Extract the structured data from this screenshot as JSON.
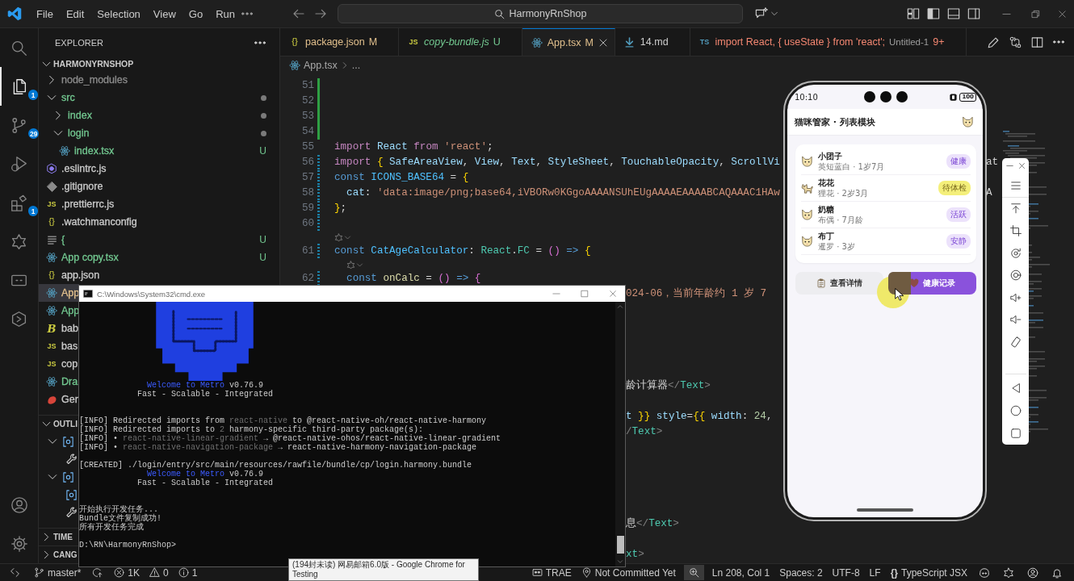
{
  "titlebar": {
    "menu": [
      {
        "label": "File"
      },
      {
        "label": "Edit"
      },
      {
        "label": "Selection"
      },
      {
        "label": "View"
      },
      {
        "label": "Go"
      },
      {
        "label": "Run"
      }
    ],
    "search": {
      "value": "HarmonyRnShop"
    }
  },
  "activity_bar": {
    "items": [
      {
        "kind": "search",
        "selected": false
      },
      {
        "kind": "explorer",
        "selected": true,
        "badge": "1"
      },
      {
        "kind": "source-control",
        "selected": false,
        "badge": "29"
      },
      {
        "kind": "run-debug",
        "selected": false
      },
      {
        "kind": "extensions",
        "selected": false,
        "badge": "1"
      },
      {
        "kind": "spark",
        "selected": false
      },
      {
        "kind": "remote",
        "selected": false
      },
      {
        "kind": "hexagon",
        "selected": false
      }
    ],
    "bottom": [
      {
        "kind": "account"
      },
      {
        "kind": "settings"
      }
    ]
  },
  "sidebar": {
    "title": "EXPLORER",
    "project": {
      "title": "HARMONYRNSHOP",
      "expanded": true,
      "items": [
        {
          "kind": "folder",
          "label": "node_modules",
          "expanded": false,
          "selected": false,
          "color": "#8c8c8c"
        },
        {
          "kind": "folder",
          "label": "src",
          "expanded": true,
          "selected": false,
          "color": "#73c991",
          "dot": true,
          "children": [
            {
              "kind": "folder",
              "label": "index",
              "expanded": false,
              "selected": false,
              "color": "#73c991",
              "dot": true
            },
            {
              "kind": "folder",
              "label": "login",
              "expanded": true,
              "selected": false,
              "color": "#73c991",
              "dot": true,
              "children": [
                {
                  "kind": "tsx",
                  "label": "index.tsx",
                  "selected": false,
                  "color": "#73c991",
                  "badge": "U"
                }
              ]
            }
          ]
        },
        {
          "kind": "eslint",
          "label": ".eslintrc.js",
          "selected": false,
          "color": "#cccccc"
        },
        {
          "kind": "git",
          "label": ".gitignore",
          "selected": false,
          "color": "#cccccc"
        },
        {
          "kind": "js",
          "icon_text": "JS",
          "label": ".prettierrc.js",
          "selected": false,
          "color": "#cccccc"
        },
        {
          "kind": "json",
          "icon_text": "{}",
          "label": ".watchmanconfig",
          "selected": false,
          "color": "#cccccc"
        },
        {
          "kind": "text",
          "label": "{",
          "selected": false,
          "color": "#73c991",
          "badge": "U"
        },
        {
          "kind": "tsx",
          "label": "App copy.tsx",
          "selected": false,
          "color": "#73c991",
          "badge": "U"
        },
        {
          "kind": "json",
          "icon_text": "{}",
          "label": "app.json",
          "selected": false,
          "color": "#cccccc"
        },
        {
          "kind": "tsx",
          "label": "App",
          "selected": true,
          "color": "#e2c08d"
        },
        {
          "kind": "tsx",
          "label": "App",
          "selected": false,
          "color": "#73c991"
        },
        {
          "kind": "babel",
          "icon_text": "B",
          "label": "bab",
          "selected": false,
          "color": "#cccccc"
        },
        {
          "kind": "js",
          "icon_text": "JS",
          "label": "bas",
          "selected": false,
          "color": "#cccccc"
        },
        {
          "kind": "js",
          "icon_text": "JS",
          "label": "cop",
          "selected": false,
          "color": "#cccccc"
        },
        {
          "kind": "tsx",
          "label": "Dra",
          "selected": false,
          "color": "#73c991"
        },
        {
          "kind": "gem",
          "label": "Ger",
          "selected": false,
          "color": "#cccccc"
        }
      ]
    },
    "outline": {
      "title": "OUTLI",
      "expanded": true,
      "items": [
        {
          "kind": "variable",
          "expanded": true,
          "children": [
            {
              "kind": "property"
            }
          ]
        },
        {
          "kind": "variable",
          "expanded": true,
          "children": [
            {
              "kind": "variable"
            },
            {
              "kind": "property"
            }
          ]
        }
      ]
    },
    "collapsed_sections": [
      {
        "title": "TIME",
        "expanded": false
      },
      {
        "title": "CANG",
        "expanded": false
      }
    ]
  },
  "editor": {
    "tabs": [
      {
        "kind": "json",
        "icon_text": "{}",
        "label": "package.json",
        "status": "M",
        "color": "#e2c08d",
        "selected": false,
        "italic": false
      },
      {
        "kind": "js",
        "icon_text": "JS",
        "label": "copy-bundle.js",
        "status": "U",
        "color": "#73c991",
        "selected": false,
        "italic": true
      },
      {
        "kind": "tsx",
        "label": "App.tsx",
        "status": "M",
        "color": "#e2c08d",
        "selected": true,
        "italic": false
      },
      {
        "kind": "md",
        "label": "14.md",
        "color": "#cccccc",
        "selected": false,
        "italic": false
      },
      {
        "kind": "ts",
        "icon_text": "TS",
        "label": "import React, { useState } from 'react';",
        "description": "Untitled-1",
        "status": "9+",
        "color": "#f48771",
        "selected": false,
        "italic": false
      }
    ],
    "breadcrumb": [
      {
        "label": "App.tsx",
        "kind": "tsx"
      },
      {
        "label": "..."
      }
    ],
    "lines": [
      {
        "kind": "code",
        "number": "51",
        "added": true
      },
      {
        "kind": "code",
        "number": "52",
        "added": true
      },
      {
        "kind": "code",
        "number": "53",
        "added": true
      },
      {
        "kind": "code",
        "number": "54",
        "added": true
      },
      {
        "kind": "code",
        "number": "55",
        "tokens": [
          {
            "text": "import",
            "kind": "kw2"
          },
          {
            "text": " React",
            "kind": "var"
          },
          {
            "text": " from",
            "kind": "kw2"
          },
          {
            "text": " 'react'",
            "kind": "str"
          },
          {
            "text": ";"
          }
        ]
      },
      {
        "kind": "code",
        "number": "56",
        "modified": true,
        "tokens": [
          {
            "text": "import",
            "kind": "kw2"
          },
          {
            "text": " {",
            "kind": "brace"
          },
          {
            "text": " SafeAreaView",
            "kind": "var"
          },
          {
            "text": ", "
          },
          {
            "text": "View",
            "kind": "var"
          },
          {
            "text": ", "
          },
          {
            "text": "Text",
            "kind": "var"
          },
          {
            "text": ", "
          },
          {
            "text": "StyleSheet",
            "kind": "var"
          },
          {
            "text": ", "
          },
          {
            "text": "TouchableOpacity",
            "kind": "var"
          },
          {
            "text": ", "
          },
          {
            "text": "ScrollVi",
            "kind": "var"
          }
        ],
        "tail": "at"
      },
      {
        "kind": "code",
        "number": "57",
        "modified": true,
        "tokens": [
          {
            "text": "const",
            "kind": "kw"
          },
          {
            "text": " ICONS_BASE64",
            "kind": "cst"
          },
          {
            "text": " = "
          },
          {
            "text": "{",
            "kind": "brace"
          }
        ]
      },
      {
        "kind": "code",
        "number": "58",
        "modified": true,
        "tokens": [
          {
            "text": "  cat",
            "kind": "var"
          },
          {
            "text": ": "
          },
          {
            "text": "'data:image/png;base64,iVBORw0KGgoAAAANSUhEUgAAAAEAAAABCAQAAAC1HAw",
            "kind": "str"
          }
        ],
        "tail": "A"
      },
      {
        "kind": "code",
        "number": "59",
        "modified": true,
        "tokens": [
          {
            "text": "}",
            "kind": "brace"
          },
          {
            "text": ";"
          }
        ]
      },
      {
        "kind": "code",
        "number": "60",
        "modified": true
      },
      {
        "kind": "lens",
        "nested": false
      },
      {
        "kind": "code",
        "number": "61",
        "modified": true,
        "tokens": [
          {
            "text": "const",
            "kind": "kw"
          },
          {
            "text": " CatAgeCalculator",
            "kind": "cst"
          },
          {
            "text": ": "
          },
          {
            "text": "React",
            "kind": "type"
          },
          {
            "text": "."
          },
          {
            "text": "FC",
            "kind": "type"
          },
          {
            "text": " = "
          },
          {
            "text": "()",
            "kind": "paren"
          },
          {
            "text": " =>",
            "kind": "kw"
          },
          {
            "text": " {",
            "kind": "brace"
          }
        ]
      },
      {
        "kind": "lens",
        "nested": true
      },
      {
        "kind": "code",
        "number": "62",
        "modified": true,
        "tokens": [
          {
            "text": "  const",
            "kind": "kw"
          },
          {
            "text": " onCalc",
            "kind": "fn"
          },
          {
            "text": " = "
          },
          {
            "text": "()",
            "kind": "paren"
          },
          {
            "text": " =>",
            "kind": "kw"
          },
          {
            "text": " {",
            "kind": "paren"
          }
        ]
      },
      {
        "kind": "covered",
        "tokens": [
          {
            "text": "024-06，当前年龄约 1 岁 7",
            "kind": "str"
          }
        ]
      },
      {
        "kind": "covered"
      },
      {
        "kind": "covered"
      },
      {
        "kind": "covered"
      },
      {
        "kind": "covered"
      },
      {
        "kind": "covered"
      },
      {
        "kind": "covered",
        "tokens": [
          {
            "text": "龄计算器"
          },
          {
            "text": "</",
            "kind": "tagp"
          },
          {
            "text": "Text",
            "kind": "type"
          },
          {
            "text": ">",
            "kind": "tagp"
          }
        ]
      },
      {
        "kind": "covered"
      },
      {
        "kind": "covered",
        "tokens": [
          {
            "text": "t",
            "kind": "var"
          },
          {
            "text": " }}",
            "kind": "brace"
          },
          {
            "text": " style",
            "kind": "var"
          },
          {
            "text": "="
          },
          {
            "text": "{{",
            "kind": "brace"
          },
          {
            "text": " width",
            "kind": "var"
          },
          {
            "text": ": "
          },
          {
            "text": "24",
            "kind": "num"
          },
          {
            "text": ","
          }
        ]
      },
      {
        "kind": "covered",
        "tokens": [
          {
            "text": "/",
            "kind": "tagp"
          },
          {
            "text": "Text",
            "kind": "type"
          },
          {
            "text": ">",
            "kind": "tagp"
          }
        ]
      },
      {
        "kind": "covered"
      },
      {
        "kind": "covered"
      },
      {
        "kind": "covered"
      },
      {
        "kind": "covered"
      },
      {
        "kind": "covered"
      },
      {
        "kind": "covered",
        "tokens": [
          {
            "text": "息"
          },
          {
            "text": "</",
            "kind": "tagp"
          },
          {
            "text": "Text",
            "kind": "type"
          },
          {
            "text": ">",
            "kind": "tagp"
          }
        ]
      },
      {
        "kind": "covered"
      },
      {
        "kind": "covered",
        "tokens": [
          {
            "text": "xt",
            "kind": "type"
          },
          {
            "text": ">",
            "kind": "tagp"
          }
        ]
      }
    ]
  },
  "terminal": {
    "title": "C:\\Windows\\System32\\cmd.exe",
    "lines": [
      {
        "kind": "banner",
        "segments": [
          {
            "text": "Welcome to Metro",
            "kind": "blue"
          },
          {
            "text": " v0.76.9"
          }
        ]
      },
      {
        "kind": "banner",
        "segments": [
          {
            "text": "Fast - Scalable - Integrated"
          }
        ]
      },
      {
        "kind": "blank"
      },
      {
        "kind": "blank"
      },
      {
        "kind": "log",
        "segments": [
          {
            "text": "[INFO] Redirected imports from "
          },
          {
            "text": "react-native",
            "kind": "dim"
          },
          {
            "text": " to @react-native-oh/react-native-harmony"
          }
        ]
      },
      {
        "kind": "log",
        "segments": [
          {
            "text": "[INFO] Redirected imports to "
          },
          {
            "text": "2",
            "kind": "dim"
          },
          {
            "text": " harmony-specific third-party package(s):"
          }
        ]
      },
      {
        "kind": "log",
        "segments": [
          {
            "text": "[INFO] • "
          },
          {
            "text": "react-native-linear-gradient",
            "kind": "dim"
          },
          {
            "text": " → @react-native-ohos/react-native-linear-gradient"
          }
        ]
      },
      {
        "kind": "log",
        "segments": [
          {
            "text": "[INFO] • "
          },
          {
            "text": "react-native-navigation-package",
            "kind": "dim"
          },
          {
            "text": " → react-native-harmony-navigation-package"
          }
        ]
      },
      {
        "kind": "blank"
      },
      {
        "kind": "log",
        "segments": [
          {
            "text": "[CREATED] ./login/entry/src/main/resources/rawfile/bundle/cp/login.harmony.bundle"
          }
        ]
      },
      {
        "kind": "banner",
        "segments": [
          {
            "text": "Welcome to Metro",
            "kind": "blue"
          },
          {
            "text": " v0.76.9"
          }
        ]
      },
      {
        "kind": "banner",
        "segments": [
          {
            "text": "Fast - Scalable - Integrated"
          }
        ]
      },
      {
        "kind": "blank"
      },
      {
        "kind": "blank"
      },
      {
        "kind": "log",
        "segments": [
          {
            "text": "开始执行开发任务..."
          }
        ]
      },
      {
        "kind": "log",
        "segments": [
          {
            "text": "Bundle文件复制成功!"
          }
        ]
      },
      {
        "kind": "log",
        "segments": [
          {
            "text": "所有开发任务完成"
          }
        ]
      },
      {
        "kind": "blank"
      },
      {
        "kind": "log",
        "segments": [
          {
            "text": "D:\\RN\\HarmonyRnShop>"
          }
        ]
      }
    ]
  },
  "emulator": {
    "status": {
      "time": "10:10",
      "battery": "100"
    },
    "app": {
      "title": "猫咪管家 · 列表模块",
      "pets": [
        {
          "kind": "face",
          "name": "小团子",
          "info": "英短蓝白 · 1岁7月",
          "tag": {
            "label": "健康",
            "kind": "normal"
          }
        },
        {
          "kind": "body",
          "name": "花花",
          "info": "狸花 · 2岁3月",
          "tag": {
            "label": "待体检",
            "kind": "alert"
          }
        },
        {
          "kind": "face",
          "name": "奶糖",
          "info": "布偶 · 7月龄",
          "tag": {
            "label": "活跃",
            "kind": "normal"
          }
        },
        {
          "kind": "face",
          "name": "布丁",
          "info": "暹罗 · 3岁",
          "tag": {
            "label": "安静",
            "kind": "normal"
          }
        }
      ],
      "actions": [
        {
          "kind": "secondary",
          "label": "查看详情"
        },
        {
          "kind": "primary",
          "label": "健康记录"
        }
      ]
    }
  },
  "tooltip": {
    "text": "(194封未读) 网易邮箱6.0版 - Google Chrome for Testing"
  },
  "status_bar": {
    "branch": "master*",
    "problems": [
      {
        "kind": "error",
        "count": "1K"
      },
      {
        "kind": "warning",
        "count": "0"
      },
      {
        "kind": "info",
        "count": "1"
      }
    ],
    "right": [
      {
        "kind": "trae",
        "label": "TRAE"
      },
      {
        "kind": "blame",
        "label": "Not Committed Yet"
      },
      {
        "kind": "zoom"
      },
      {
        "kind": "text",
        "label": "Ln 208, Col 1"
      },
      {
        "kind": "text",
        "label": "Spaces: 2"
      },
      {
        "kind": "text",
        "label": "UTF-8"
      },
      {
        "kind": "text",
        "label": "LF"
      },
      {
        "kind": "language",
        "icon_text": "{}",
        "label": "TypeScript JSX"
      },
      {
        "kind": "copilot"
      },
      {
        "kind": "spark"
      },
      {
        "kind": "account"
      },
      {
        "kind": "bell"
      }
    ]
  }
}
